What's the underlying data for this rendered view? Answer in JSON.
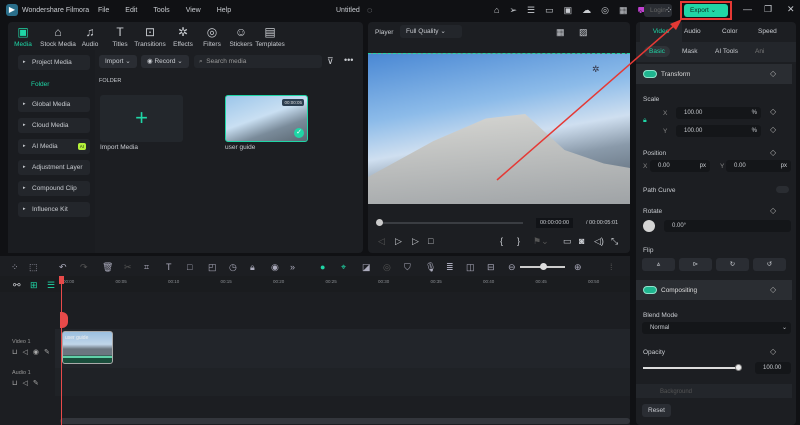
{
  "app": {
    "title": "Wondershare Filmora",
    "project": "Untitled",
    "menu": [
      "File",
      "Edit",
      "Tools",
      "View",
      "Help"
    ],
    "login": "Login",
    "export": "Export"
  },
  "tabs": [
    {
      "label": "Media",
      "icon": "media-icon"
    },
    {
      "label": "Stock Media",
      "icon": "stock-icon"
    },
    {
      "label": "Audio",
      "icon": "audio-icon"
    },
    {
      "label": "Titles",
      "icon": "titles-icon"
    },
    {
      "label": "Transitions",
      "icon": "transitions-icon"
    },
    {
      "label": "Effects",
      "icon": "effects-icon"
    },
    {
      "label": "Filters",
      "icon": "filters-icon"
    },
    {
      "label": "Stickers",
      "icon": "stickers-icon"
    },
    {
      "label": "Templates",
      "icon": "templates-icon"
    }
  ],
  "sidebar": {
    "project_media": "Project Media",
    "folder": "Folder",
    "items": [
      "Global Media",
      "Cloud Media",
      "AI Media",
      "Adjustment Layer",
      "Compound Clip",
      "Influence Kit"
    ],
    "ai_badge": "AI"
  },
  "media": {
    "import": "Import",
    "record": "Record",
    "search_placeholder": "Search media",
    "folder_heading": "FOLDER",
    "import_media": "Import Media",
    "clip_name": "user guide",
    "clip_duration": "00:00:05"
  },
  "player": {
    "label": "Player",
    "quality": "Full Quality",
    "current_time": "00:00:00:00",
    "total_time": "/ 00:00:05:01"
  },
  "props": {
    "tabs": [
      "Video",
      "Audio",
      "Color",
      "Speed"
    ],
    "subtabs": [
      "Basic",
      "Mask",
      "AI Tools",
      "Ani"
    ],
    "transform": "Transform",
    "scale": "Scale",
    "scale_x": "100.00",
    "scale_y": "100.00",
    "percent": "%",
    "x": "X",
    "y": "Y",
    "position": "Position",
    "pos_x": "0.00",
    "pos_y": "0.00",
    "px": "px",
    "path_curve": "Path Curve",
    "rotate": "Rotate",
    "rotate_val": "0.00°",
    "flip": "Flip",
    "compositing": "Compositing",
    "blend_mode": "Blend Mode",
    "blend_val": "Normal",
    "opacity": "Opacity",
    "opacity_val": "100.00",
    "opacity_fraction": 1.0,
    "background": "Background",
    "reset": "Reset"
  },
  "timeline": {
    "ticks": [
      "00:00",
      "00:05",
      "00:10",
      "00:15",
      "00:20",
      "00:25",
      "00:30",
      "00:35",
      "00:40",
      "00:45",
      "00:50"
    ],
    "video_track": "Video 1",
    "audio_track": "Audio 1",
    "clip_label": "user guide"
  },
  "colors": {
    "accent": "#1fd6a6",
    "export_border": "#e53935",
    "playhead": "#e84a4a"
  }
}
